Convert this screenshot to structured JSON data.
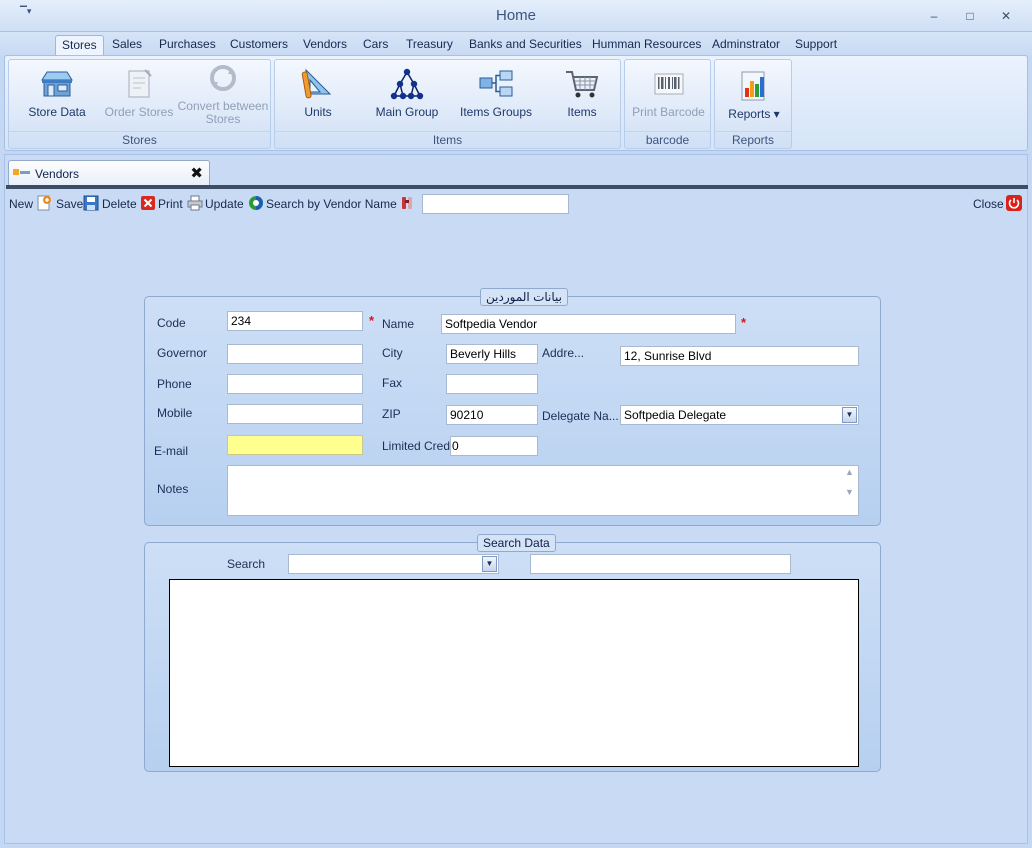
{
  "window": {
    "title": "Home",
    "quick_access": "▔▾",
    "minimize": "–",
    "maximize": "□",
    "close": "✕"
  },
  "menu": {
    "tabs": [
      "Stores",
      "Sales",
      "Purchases",
      "Customers",
      "Vendors",
      "Cars",
      "Treasury",
      "Banks and Securities",
      "Humman Resources",
      "Adminstrator",
      "Support"
    ],
    "active": "Stores"
  },
  "ribbon": {
    "groups": [
      {
        "label": "Stores",
        "buttons": [
          {
            "label": "Store Data",
            "icon": "store-icon",
            "enabled": true
          },
          {
            "label": "Order Stores",
            "icon": "order-stores-icon",
            "enabled": false
          },
          {
            "label": "Convert between Stores",
            "icon": "convert-icon",
            "enabled": false
          }
        ]
      },
      {
        "label": "Items",
        "buttons": [
          {
            "label": "Units",
            "icon": "units-icon",
            "enabled": true
          },
          {
            "label": "Main Group",
            "icon": "main-group-icon",
            "enabled": true
          },
          {
            "label": "Items Groups",
            "icon": "items-groups-icon",
            "enabled": true
          },
          {
            "label": "Items",
            "icon": "cart-icon",
            "enabled": true
          }
        ]
      },
      {
        "label": "barcode",
        "buttons": [
          {
            "label": "Print Barcode",
            "icon": "barcode-icon",
            "enabled": false
          }
        ]
      },
      {
        "label": "Reports",
        "buttons": [
          {
            "label": "Reports",
            "icon": "reports-icon",
            "enabled": true,
            "dropdown": "▾"
          }
        ]
      }
    ]
  },
  "doc_tab": {
    "label": "Vendors",
    "close": "✖"
  },
  "toolbar": {
    "new": "New",
    "save": "Save",
    "delete": "Delete",
    "print": "Print",
    "update": "Update",
    "search_by_name": "Search by Vendor Name",
    "close": "Close",
    "search_value": ""
  },
  "vendor_form": {
    "legend": "بيانات الموردين",
    "code_label": "Code",
    "code_value": "234",
    "required_mark": "*",
    "name_label": "Name",
    "name_value": "Softpedia Vendor",
    "governor_label": "Governor",
    "governor_value": "",
    "city_label": "City",
    "city_value": "Beverly Hills",
    "address_label": "Addre...",
    "address_value": "12, Sunrise Blvd",
    "phone_label": "Phone",
    "phone_value": "",
    "fax_label": "Fax",
    "fax_value": "",
    "mobile_label": "Mobile",
    "mobile_value": "",
    "zip_label": "ZIP",
    "zip_value": "90210",
    "delegate_label": "Delegate Na...",
    "delegate_value": "Softpedia Delegate",
    "email_label": "E-mail",
    "email_value": "",
    "limited_credit_label": "Limited Credit",
    "limited_credit_value": "0",
    "notes_label": "Notes",
    "notes_value": ""
  },
  "search_panel": {
    "legend": "Search Data",
    "search_label": "Search",
    "search_field_value": "",
    "search_text_value": ""
  },
  "colors": {
    "accent": "#3c557f",
    "required": "#d3161a",
    "email_highlight": "#ffff8f"
  }
}
